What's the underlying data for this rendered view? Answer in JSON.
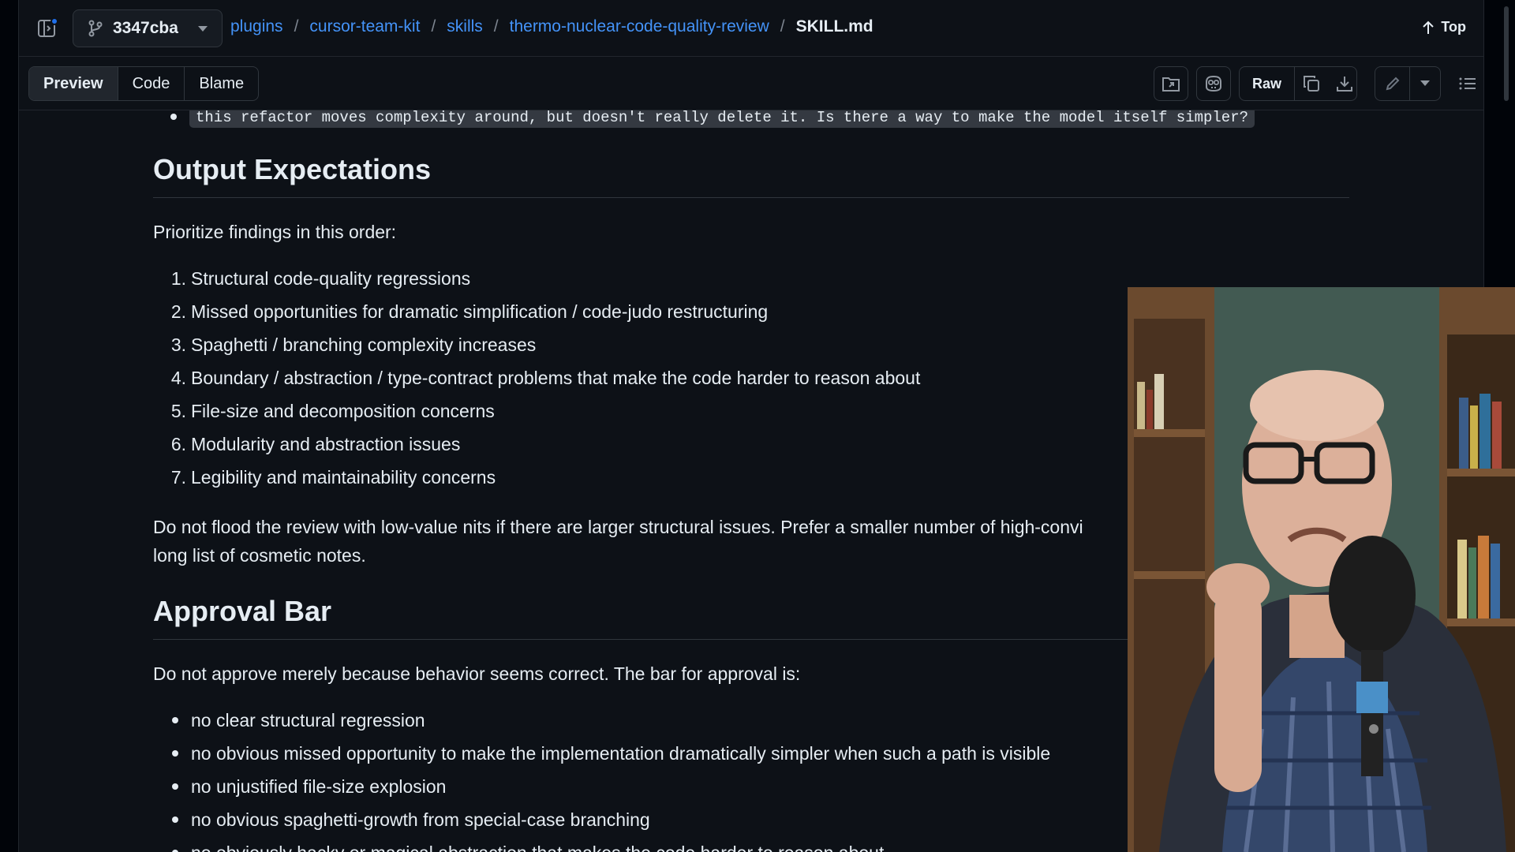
{
  "header": {
    "branch": "3347cba",
    "breadcrumbs": [
      "plugins",
      "cursor-team-kit",
      "skills",
      "thermo-nuclear-code-quality-review"
    ],
    "separator": "/",
    "file": "SKILL.md",
    "top_label": "Top"
  },
  "toolbar": {
    "tabs": [
      "Preview",
      "Code",
      "Blame"
    ],
    "raw_label": "Raw"
  },
  "content": {
    "partial_code_line": "this refactor moves complexity around, but doesn't really delete it. Is there a way to make the model itself simpler?",
    "section1": {
      "heading": "Output Expectations",
      "intro": "Prioritize findings in this order:",
      "items": [
        "Structural code-quality regressions",
        "Missed opportunities for dramatic simplification / code-judo restructuring",
        "Spaghetti / branching complexity increases",
        "Boundary / abstraction / type-contract problems that make the code harder to reason about",
        "File-size and decomposition concerns",
        "Modularity and abstraction issues",
        "Legibility and maintainability concerns"
      ],
      "note": "Do not flood the review with low-value nits if there are larger structural issues. Prefer a smaller number of high-convi",
      "note2": "long list of cosmetic notes."
    },
    "section2": {
      "heading": "Approval Bar",
      "intro": "Do not approve merely because behavior seems correct. The bar for approval is:",
      "items": [
        "no clear structural regression",
        "no obvious missed opportunity to make the implementation dramatically simpler when such a path is visible",
        "no unjustified file-size explosion",
        "no obvious spaghetti-growth from special-case branching",
        "no obviously hacky or magical abstraction that makes the code harder to reason about"
      ]
    }
  },
  "colors": {
    "background": "#0d1117",
    "link": "#4493f8",
    "border": "#30363d",
    "text": "#e6edf3"
  },
  "icons": [
    "sidebar-toggle-icon",
    "branch-icon",
    "chevron-down-icon",
    "arrow-up-icon",
    "open-folder-icon",
    "copilot-icon",
    "copy-icon",
    "download-icon",
    "pencil-icon",
    "list-icon"
  ]
}
